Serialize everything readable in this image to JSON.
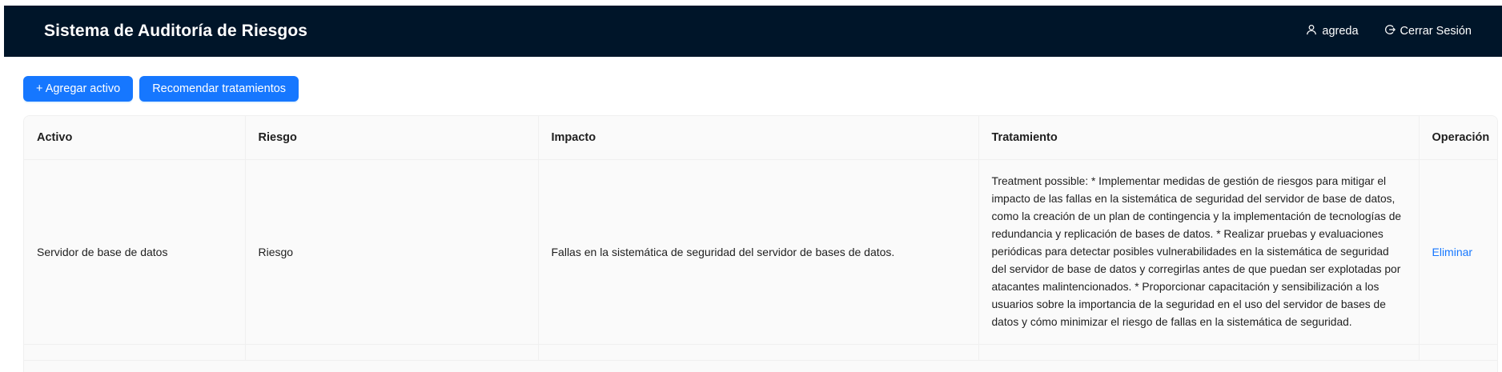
{
  "header": {
    "title": "Sistema de Auditoría de Riesgos",
    "user": {
      "icon": "user-icon",
      "label": "agreda"
    },
    "logout": {
      "icon": "logout-icon",
      "label": "Cerrar Sesión"
    },
    "background": "#001529"
  },
  "toolbar": {
    "add_label": "+ Agregar activo",
    "recommend_label": "Recomendar tratamientos",
    "accent": "#1677ff"
  },
  "table": {
    "columns": [
      "Activo",
      "Riesgo",
      "Impacto",
      "Tratamiento",
      "Operación"
    ],
    "rows": [
      {
        "activo": "Servidor de base de datos",
        "riesgo": "Riesgo",
        "impacto": "Fallas en la sistemática de seguridad del servidor de bases de datos.",
        "tratamiento": "Treatment possible: * Implementar medidas de gestión de riesgos para mitigar el impacto de las fallas en la sistemática de seguridad del servidor de base de datos, como la creación de un plan de contingencia y la implementación de tecnologías de redundancia y replicación de bases de datos. * Realizar pruebas y evaluaciones periódicas para detectar posibles vulnerabilidades en la sistemática de seguridad del servidor de base de datos y corregirlas antes de que puedan ser explotadas por atacantes malintencionados. * Proporcionar capacitación y sensibilización a los usuarios sobre la importancia de la seguridad en el uso del servidor de bases de datos y cómo minimizar el riesgo de fallas en la sistemática de seguridad.",
        "operacion": "Eliminar"
      }
    ]
  }
}
